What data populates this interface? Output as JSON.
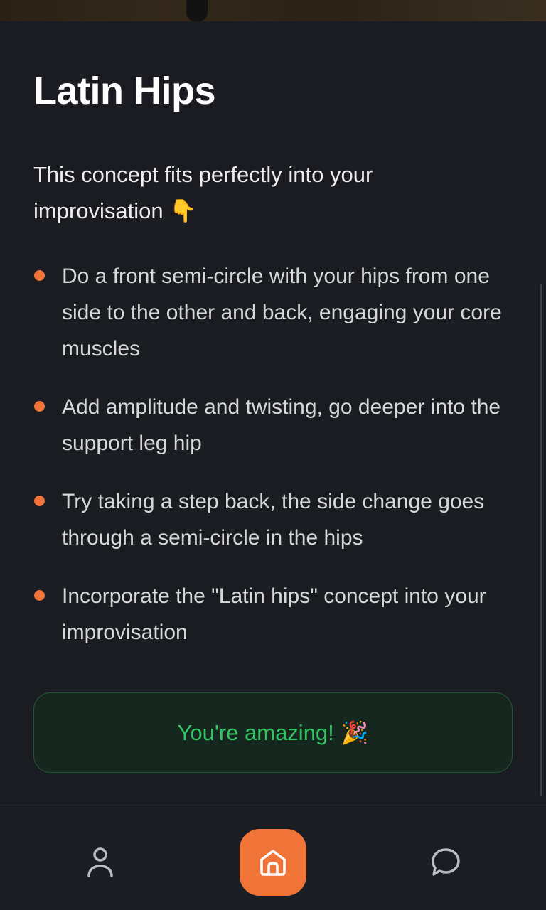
{
  "hero": {
    "image_description": ""
  },
  "lesson": {
    "title": "Latin Hips",
    "intro": "This concept fits perfectly into your improvisation",
    "intro_emoji": "👇",
    "bullets": [
      "Do a front semi-circle with your hips from one side to the other and back, engaging your core muscles",
      "Add amplitude and twisting, go deeper into the support leg hip",
      "Try taking a step back, the side change goes through a semi-circle in the hips",
      "Incorporate the \"Latin hips\" concept into your improvisation"
    ]
  },
  "cta": {
    "label": "You're amazing!",
    "emoji": "🎉"
  },
  "nav": {
    "items": [
      {
        "icon": "profile-icon",
        "active": false
      },
      {
        "icon": "home-icon",
        "active": true
      },
      {
        "icon": "chat-icon",
        "active": false
      }
    ]
  },
  "colors": {
    "background": "#1b1c21",
    "accent": "#f07338",
    "success": "#35c463"
  }
}
